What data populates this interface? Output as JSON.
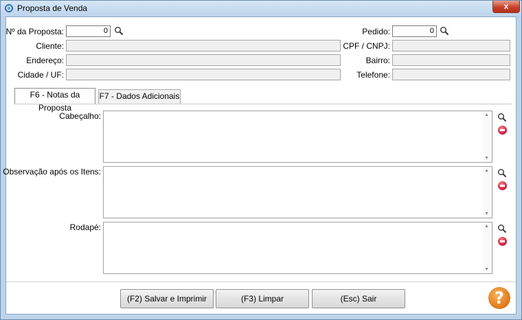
{
  "window": {
    "title": "Proposta de Venda",
    "close_label": "x"
  },
  "header": {
    "proposta": {
      "label": "Nº da Proposta:",
      "value": "0"
    },
    "cliente": {
      "label": "Cliente:",
      "value": ""
    },
    "endereco": {
      "label": "Endereço:",
      "value": ""
    },
    "cidade_uf": {
      "label": "Cidade / UF:",
      "value": ""
    },
    "pedido": {
      "label": "Pedido:",
      "value": "0"
    },
    "cpf_cnpj": {
      "label": "CPF / CNPJ:",
      "value": ""
    },
    "bairro": {
      "label": "Bairro:",
      "value": ""
    },
    "telefone": {
      "label": "Telefone:",
      "value": ""
    }
  },
  "tabs": [
    {
      "label": "F6 - Notas da Proposta",
      "active": true
    },
    {
      "label": "F7 - Dados Adicionais",
      "active": false
    }
  ],
  "notes": {
    "cabecalho": {
      "label": "Cabeçalho:",
      "value": ""
    },
    "observacao": {
      "label": "Observação após os Itens:",
      "value": ""
    },
    "rodape": {
      "label": "Rodapé:",
      "value": ""
    }
  },
  "buttons": {
    "save": "(F2) Salvar e Imprimir",
    "clear": "(F3) Limpar",
    "exit": "(Esc) Sair",
    "help": "?"
  },
  "colors": {
    "help": "#e0781a",
    "delete": "#d1143a",
    "titlebar": "#bcd4ec"
  },
  "icons": [
    "app-icon",
    "search-icon",
    "delete-icon",
    "help-icon",
    "close-icon"
  ]
}
